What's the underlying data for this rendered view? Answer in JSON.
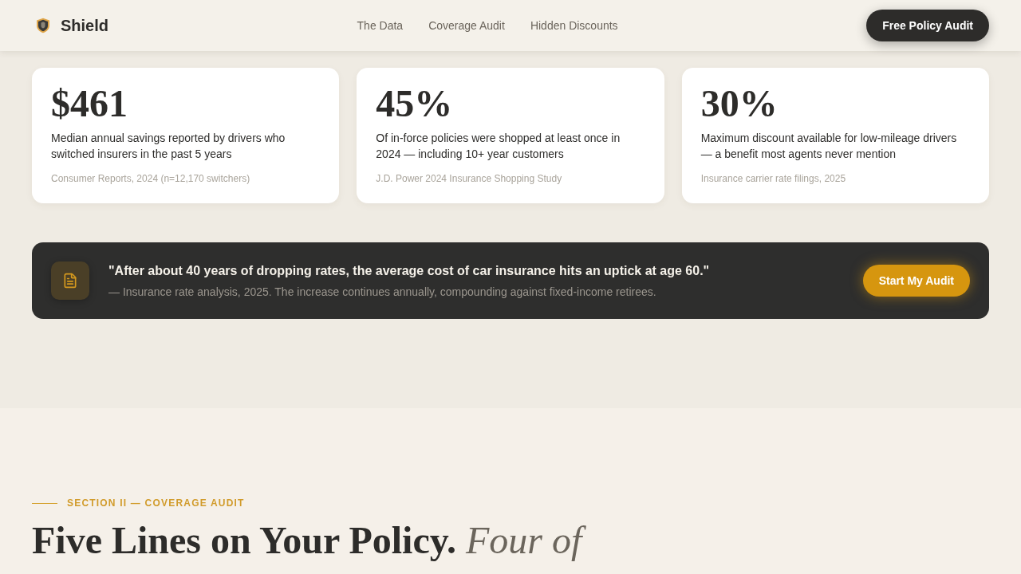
{
  "header": {
    "logo": "Shield",
    "nav": [
      "The Data",
      "Coverage Audit",
      "Hidden Discounts"
    ],
    "cta": "Free Policy Audit"
  },
  "stats": [
    {
      "value": "$461",
      "description": "Median annual savings reported by drivers who switched insurers in the past 5 years",
      "source": "Consumer Reports, 2024 (n=12,170 switchers)"
    },
    {
      "value": "45%",
      "description": "Of in-force policies were shopped at least once in 2024 — including 10+ year customers",
      "source": "J.D. Power 2024 Insurance Shopping Study"
    },
    {
      "value": "30%",
      "description": "Maximum discount available for low-mileage drivers — a benefit most agents never mention",
      "source": "Insurance carrier rate filings, 2025"
    }
  ],
  "callout": {
    "quote": "\"After about 40 years of dropping rates, the average cost of car insurance hits an uptick at age 60.\"",
    "attribution": "— Insurance rate analysis, 2025. The increase continues annually, compounding against fixed-income retirees.",
    "button": "Start My Audit"
  },
  "section": {
    "eyebrow": "SECTION II — COVERAGE AUDIT",
    "heading": "Five Lines on Your Policy. *Four of*"
  }
}
